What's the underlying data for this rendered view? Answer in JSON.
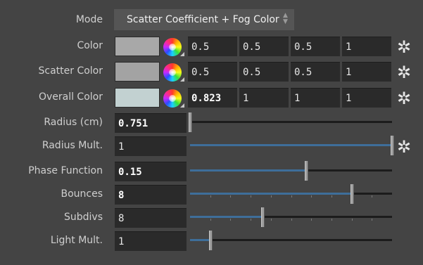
{
  "mode": {
    "label": "Mode",
    "value": "Scatter Coefficient + Fog Color"
  },
  "color_rows": [
    {
      "name": "color",
      "label": "Color",
      "swatch_color": "#a8a8a8",
      "values": [
        "0.5",
        "0.5",
        "0.5",
        "1"
      ],
      "first_bold": false
    },
    {
      "name": "scatter-color",
      "label": "Scatter Color",
      "swatch_color": "#a3a3a3",
      "values": [
        "0.5",
        "0.5",
        "0.5",
        "1"
      ],
      "first_bold": false
    },
    {
      "name": "overall-color",
      "label": "Overall Color",
      "swatch_color": "#c2d1d1",
      "values": [
        "0.823",
        "1",
        "1",
        "1"
      ],
      "first_bold": true
    }
  ],
  "slider_rows": [
    {
      "name": "radius",
      "label": "Radius (cm)",
      "value": "0.751",
      "bold": true,
      "position": 0.0,
      "gear": false,
      "ticks": false
    },
    {
      "name": "radius-mult",
      "label": "Radius Mult.",
      "value": "1",
      "bold": false,
      "position": 1.0,
      "gear": true,
      "ticks": false
    },
    {
      "name": "phase-function",
      "label": "Phase Function",
      "value": "0.15",
      "bold": true,
      "position": 0.575,
      "gear": false,
      "ticks": false
    },
    {
      "name": "bounces",
      "label": "Bounces",
      "value": "8",
      "bold": true,
      "position": 0.8,
      "gear": false,
      "ticks": true
    },
    {
      "name": "subdivs",
      "label": "Subdivs",
      "value": "8",
      "bold": false,
      "position": 0.36,
      "gear": false,
      "ticks": true
    },
    {
      "name": "light-mult",
      "label": "Light Mult.",
      "value": "1",
      "bold": false,
      "position": 0.1,
      "gear": false,
      "ticks": false
    }
  ],
  "colors": {
    "background": "#444444",
    "field": "#2a2a2a",
    "slider_fill": "#3e6e9a"
  },
  "icons": {
    "color_picker": "color-wheel-icon",
    "gear": "gear-icon",
    "mode_arrows": "updown-arrows-icon"
  }
}
